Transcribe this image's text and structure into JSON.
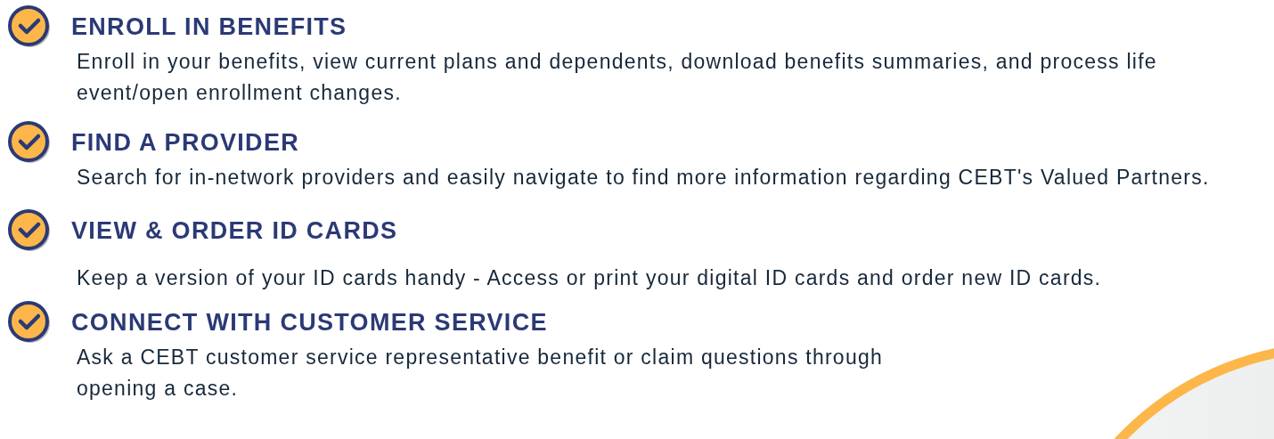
{
  "features": [
    {
      "title": "ENROLL IN BENEFITS",
      "description": "Enroll in your benefits, view current plans and dependents, download benefits summaries, and process life event/open enrollment changes."
    },
    {
      "title": "FIND A PROVIDER",
      "description": "Search for in-network providers and easily navigate to find more information regarding CEBT's Valued Partners."
    },
    {
      "title": "VIEW & ORDER ID CARDS",
      "description": "Keep a version of your ID cards handy - Access or print your digital ID cards and order new ID cards."
    },
    {
      "title": "CONNECT WITH CUSTOMER SERVICE",
      "description": "Ask a CEBT customer service representative benefit or claim questions through opening a case."
    }
  ]
}
